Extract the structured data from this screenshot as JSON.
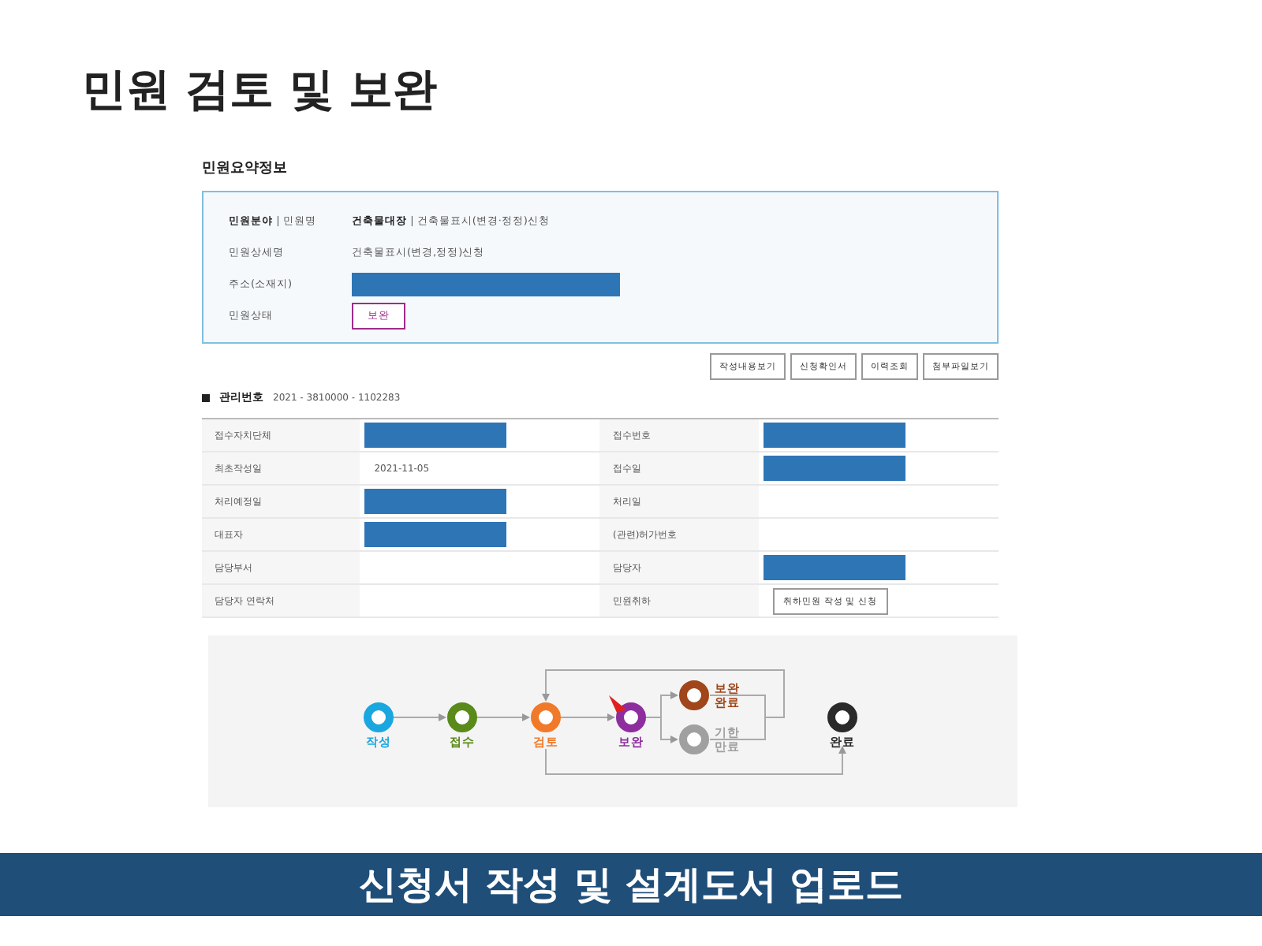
{
  "slide_title": "민원 검토 및 보완",
  "summary": {
    "heading": "민원요약정보",
    "rows": [
      {
        "kind": "split",
        "label": "**민원분야** | 민원명",
        "value": "**건축물대장** | 건축물표시(변경·정정)신청"
      },
      {
        "kind": "text",
        "label": "민원상세명",
        "value": "건축물표시(변경,정정)신청"
      },
      {
        "kind": "redacted",
        "label": "주소(소재지)"
      },
      {
        "kind": "status",
        "label": "민원상태",
        "value": "보완"
      }
    ]
  },
  "actions": [
    "작성내용보기",
    "신청확인서",
    "이력조회",
    "첨부파일보기"
  ],
  "management": {
    "label": "관리번호",
    "value": "2021 - 3810000 - 1102283"
  },
  "table": {
    "rows": [
      [
        {
          "label": "접수자치단체",
          "kind": "redacted"
        },
        {
          "label": "접수번호",
          "kind": "redacted"
        }
      ],
      [
        {
          "label": "최초작성일",
          "kind": "text",
          "value": "2021-11-05"
        },
        {
          "label": "접수일",
          "kind": "redacted"
        }
      ],
      [
        {
          "label": "처리예정일",
          "kind": "redacted"
        },
        {
          "label": "처리일",
          "kind": "empty"
        }
      ],
      [
        {
          "label": "대표자",
          "kind": "redacted"
        },
        {
          "label": "(관련)허가번호",
          "kind": "empty"
        }
      ],
      [
        {
          "label": "담당부서",
          "kind": "empty"
        },
        {
          "label": "담당자",
          "kind": "redacted"
        }
      ],
      [
        {
          "label": "담당자 연락처",
          "kind": "empty"
        },
        {
          "label": "민원취하",
          "kind": "button",
          "value": "취하민원 작성 및 신청"
        }
      ]
    ]
  },
  "flow": {
    "nodes": [
      {
        "lines": [
          "작성"
        ],
        "color": "#1aa7e0",
        "current": false
      },
      {
        "lines": [
          "접수"
        ],
        "color": "#5a8a1a",
        "current": false
      },
      {
        "lines": [
          "검토"
        ],
        "color": "#f07a2a",
        "current": false
      },
      {
        "lines": [
          "보완"
        ],
        "color": "#8e2e9e",
        "current": true
      },
      {
        "lines": [
          "보완",
          "완료"
        ],
        "color": "#a0461a",
        "current": false
      },
      {
        "lines": [
          "기한",
          "만료"
        ],
        "color": "#a0a0a0",
        "current": false
      },
      {
        "lines": [
          "완료"
        ],
        "color": "#2a2a2a",
        "current": false
      }
    ]
  },
  "footer": "신청서 작성 및 설계도서 업로드"
}
